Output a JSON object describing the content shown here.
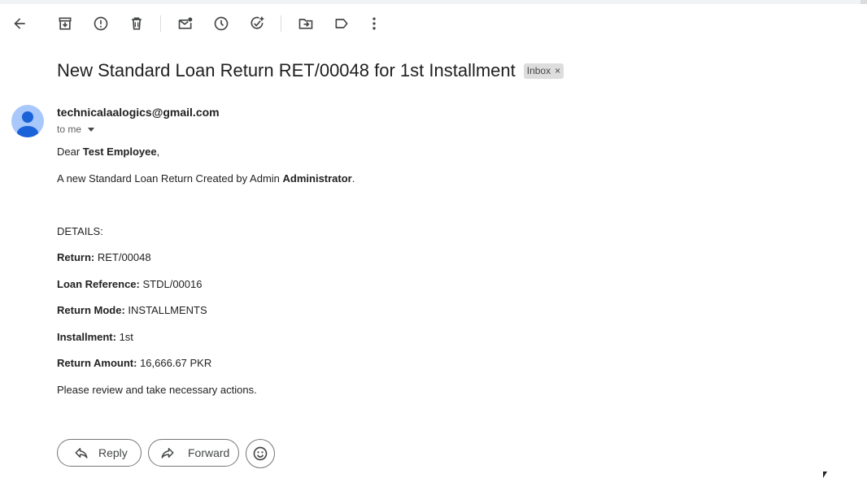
{
  "toolbar": {
    "icons": [
      "back-arrow-icon",
      "archive-icon",
      "report-spam-icon",
      "delete-icon",
      "mark-unread-icon",
      "snooze-icon",
      "add-to-tasks-icon",
      "move-to-icon",
      "label-icon",
      "more-vert-icon"
    ]
  },
  "email": {
    "subject": "New Standard Loan Return RET/00048 for 1st Installment",
    "label": "Inbox",
    "label_remove": "×",
    "sender": "technicalaalogics@gmail.com",
    "recipient_summary": "to me",
    "greeting_prefix": "Dear ",
    "greeting_name": "Test Employee",
    "greeting_suffix": ",",
    "intro_prefix": "A new Standard Loan Return Created by Admin ",
    "intro_name": "Administrator",
    "intro_suffix": ".",
    "details_heading": "DETAILS:",
    "details": [
      {
        "label": "Return:",
        "value": " RET/00048"
      },
      {
        "label": "Loan Reference:",
        "value": " STDL/00016"
      },
      {
        "label": "Return Mode:",
        "value": " INSTALLMENTS"
      },
      {
        "label": "Installment:",
        "value": " 1st"
      },
      {
        "label": "Return Amount:",
        "value": " 16,666.67 PKR"
      }
    ],
    "closing": "Please review and take necessary actions."
  },
  "actions": {
    "reply_label": "Reply",
    "forward_label": "Forward"
  }
}
